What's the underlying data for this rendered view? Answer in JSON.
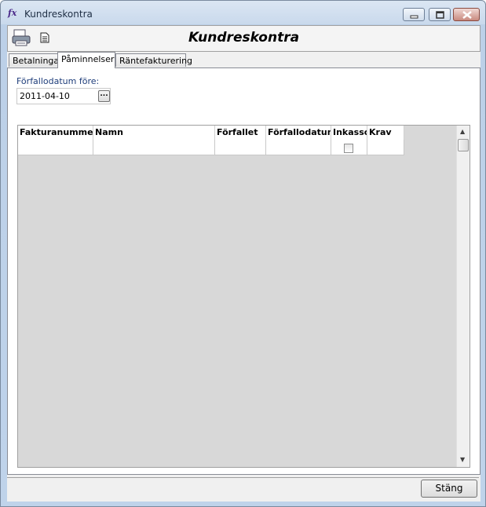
{
  "window": {
    "title": "Kundreskontra",
    "app_icon_text": "fx",
    "controls": [
      "minimize-icon",
      "maximize-icon",
      "close-icon"
    ]
  },
  "toolbar": {
    "icons": [
      "printer-icon",
      "document-icon"
    ],
    "heading": "Kundreskontra"
  },
  "tabs": [
    {
      "label": "Betalningar",
      "active": false
    },
    {
      "label": "Påminnelser",
      "active": true
    },
    {
      "label": "Räntefakturering",
      "active": false
    }
  ],
  "filter": {
    "label": "Förfallodatum före:",
    "date_value": "2011-04-10",
    "picker_label": "..."
  },
  "grid": {
    "columns": [
      "Fakturanummer",
      "Namn",
      "Förfallet",
      "Förfallodatum",
      "Inkasso",
      "Krav"
    ],
    "rows": [
      {
        "Fakturanummer": "",
        "Namn": "",
        "Förfallet": "",
        "Förfallodatum": "",
        "Inkasso": false,
        "Krav": ""
      }
    ]
  },
  "footer": {
    "close_label": "Stäng"
  }
}
